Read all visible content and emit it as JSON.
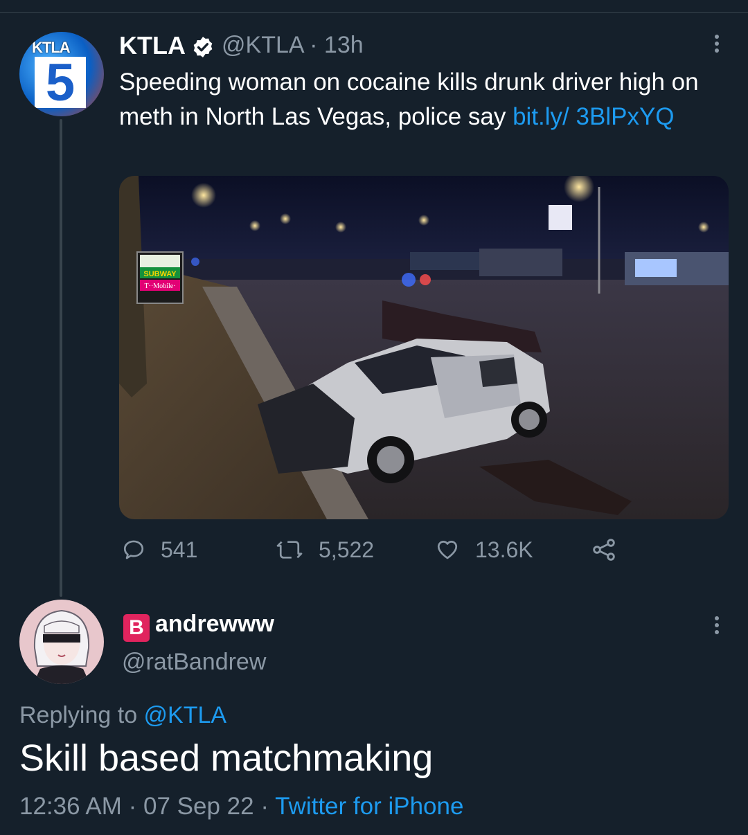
{
  "colors": {
    "background": "#15202b",
    "link": "#1d9bf0",
    "muted": "#8b98a5",
    "badge": "#e0245e"
  },
  "tweet": {
    "author_name": "KTLA",
    "verified_icon": "verified-badge-icon",
    "handle": "@KTLA",
    "separator": "·",
    "time": "13h",
    "text": "Speeding woman on cocaine kills drunk driver high on meth in North Las Vegas, police say ",
    "link": "bit.ly/ 3BlPxYQ",
    "avatar_label": "KTLA",
    "avatar_number": "5",
    "media_sign_store": "SUBWAY",
    "media_sign_carrier": "T··Mobile·",
    "stats": {
      "replies": "541",
      "retweets": "5,522",
      "likes": "13.6K"
    }
  },
  "reply": {
    "badge_letter": "B",
    "author_name": "andrewww",
    "handle": "@ratBandrew",
    "replying_prefix": "Replying to ",
    "replying_to": "@KTLA",
    "text": "Skill based matchmaking",
    "time": "12:36 AM",
    "sep1": "·",
    "date": "07 Sep 22",
    "sep2": "·",
    "source": "Twitter for iPhone"
  }
}
